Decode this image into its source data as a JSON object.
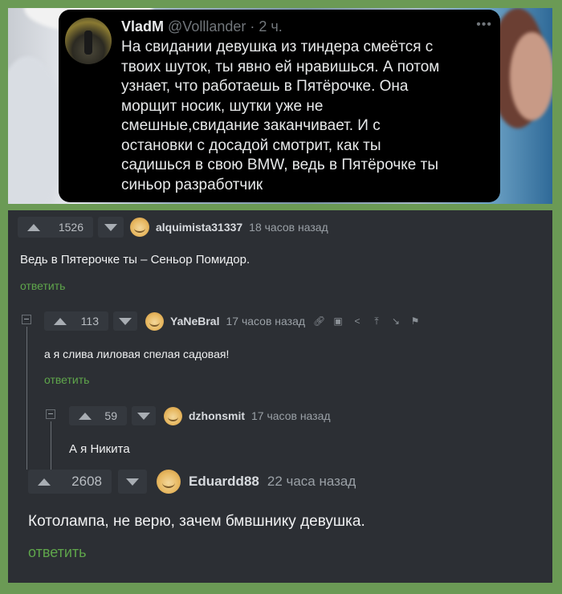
{
  "tweet": {
    "author": "VladM",
    "handle": "@Volllander",
    "time": " · 2 ч.",
    "more_icon": "more-icon",
    "text": "На свидании девушка из тиндера смеётся с\nтвоих шуток, ты явно ей нравишься. А потом\nузнает, что работаешь в Пятёрочке. Она\nморщит носик, шутки уже не\nсмешные,свидание заканчивает. И с\nостановки с досадой смотрит, как ты\nсадишься в свою BMW, ведь в Пятёрочке ты\nсиньор разработчик"
  },
  "comments": [
    {
      "votes": "1526",
      "author": "alquimista31337",
      "time": "18 часов назад",
      "text": "Ведь в Пятерочке ты – Сеньор Помидор.",
      "reply": "ответить"
    },
    {
      "votes": "113",
      "author": "YaNeBral",
      "time": "17 часов назад",
      "text": "а я слива лиловая спелая садовая!",
      "reply": "ответить",
      "tools": [
        "link-icon",
        "save-icon",
        "share-icon",
        "upload-icon",
        "pin-icon",
        "flag-icon"
      ]
    },
    {
      "votes": "59",
      "author": "dzhonsmit",
      "time": "17 часов назад",
      "text": "А я Никита"
    },
    {
      "votes": "2608",
      "author": "Eduardd88",
      "time": "22 часа назад",
      "text": "Котолампа, не верю, зачем бмвшнику девушка.",
      "reply": "ответить"
    }
  ]
}
